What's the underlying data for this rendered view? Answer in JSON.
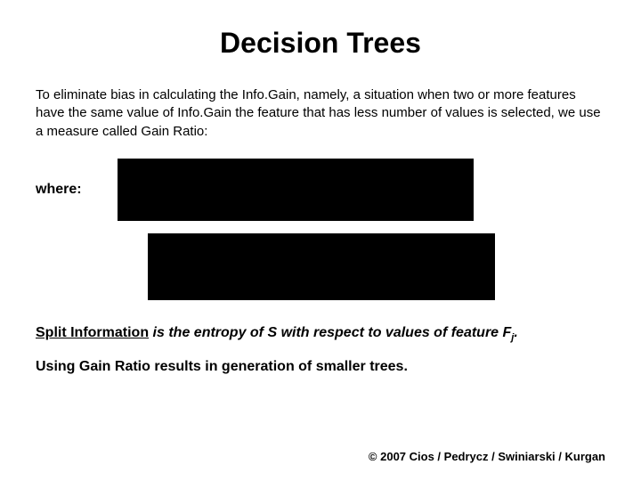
{
  "title": "Decision Trees",
  "paragraph": "To eliminate bias in calculating the Info.Gain, namely, a situation when two or more features have the same value of  Info.Gain the feature that has less number of values is selected,  we use a measure called Gain Ratio:",
  "where_label": "where:",
  "split_prefix": "Split Information",
  "split_mid": " is the entropy of S with respect to values of feature F",
  "split_sub": "j",
  "split_end": ".",
  "closing": "Using Gain Ratio results in generation of smaller trees.",
  "copyright": "© 2007 Cios / Pedrycz / Swiniarski / Kurgan"
}
